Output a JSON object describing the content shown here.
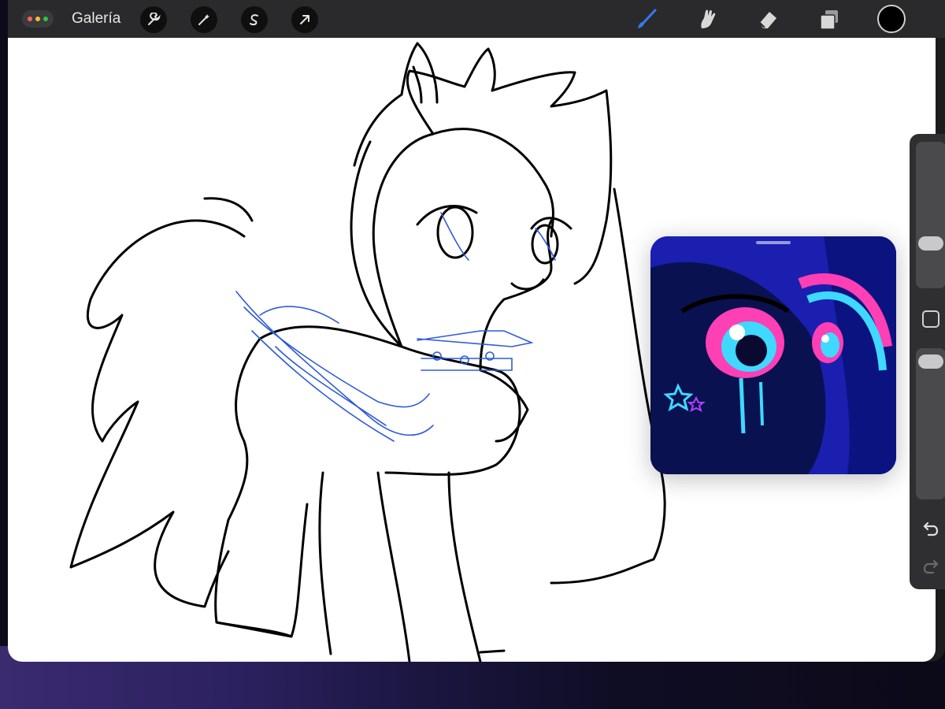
{
  "toolbar": {
    "gallery_label": "Galería",
    "left_tools": [
      {
        "name": "wrench-icon"
      },
      {
        "name": "magic-wand-icon"
      },
      {
        "name": "selection-s-icon"
      },
      {
        "name": "transform-arrow-icon"
      }
    ],
    "right_tools": [
      {
        "name": "brush-icon",
        "active": true,
        "color": "#2f7cf6"
      },
      {
        "name": "smudge-icon",
        "active": false
      },
      {
        "name": "eraser-icon",
        "active": false
      },
      {
        "name": "layers-icon",
        "active": false
      }
    ],
    "current_color": "#000000"
  },
  "sidebar": {
    "brush_size_slider": "size-slider",
    "opacity_slider": "opacity-slider",
    "modify_button": "modify-square-icon",
    "undo": "undo-icon",
    "redo": "redo-icon"
  },
  "reference": {
    "title": "reference-image",
    "colors": {
      "bg": "#1a1fb0",
      "accent_pink": "#ff3fb4",
      "accent_cyan": "#3fd8ff"
    }
  },
  "colors": {
    "accent": "#2f7cf6",
    "sketch_blue": "#2e5bd8",
    "line": "#000000"
  }
}
